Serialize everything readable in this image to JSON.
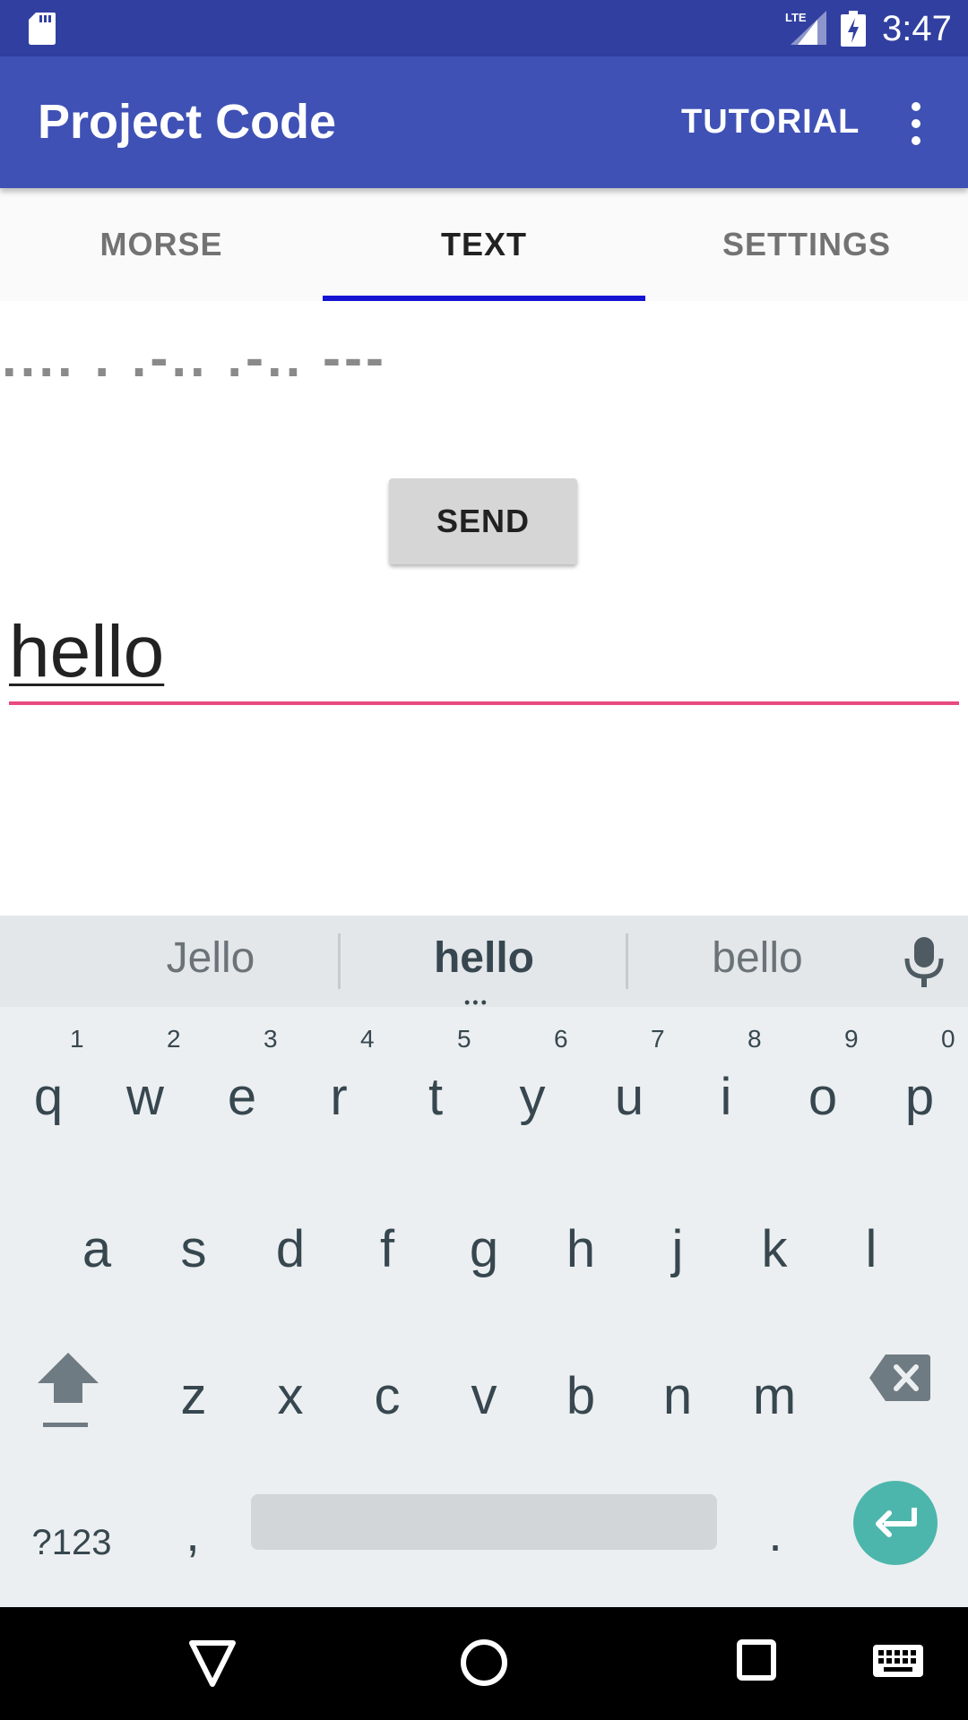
{
  "status_bar": {
    "time": "3:47",
    "icons": [
      "sd-card-icon",
      "lte-signal-icon",
      "battery-charging-icon"
    ]
  },
  "app_bar": {
    "title": "Project Code",
    "tutorial_label": "TUTORIAL",
    "menu_icon": "overflow-menu-icon"
  },
  "tabs": [
    {
      "label": "MORSE"
    },
    {
      "label": "TEXT"
    },
    {
      "label": "SETTINGS"
    }
  ],
  "active_tab": "TEXT",
  "content": {
    "morse_output": ".... . .-.. .-.. ---",
    "send_label": "SEND",
    "input_value": "hello"
  },
  "keyboard": {
    "suggestions": [
      "Jello",
      "hello",
      "bello"
    ],
    "more_indicator": "•••",
    "row1": [
      {
        "key": "q",
        "hint": "1"
      },
      {
        "key": "w",
        "hint": "2"
      },
      {
        "key": "e",
        "hint": "3"
      },
      {
        "key": "r",
        "hint": "4"
      },
      {
        "key": "t",
        "hint": "5"
      },
      {
        "key": "y",
        "hint": "6"
      },
      {
        "key": "u",
        "hint": "7"
      },
      {
        "key": "i",
        "hint": "8"
      },
      {
        "key": "o",
        "hint": "9"
      },
      {
        "key": "p",
        "hint": "0"
      }
    ],
    "row2": [
      "a",
      "s",
      "d",
      "f",
      "g",
      "h",
      "j",
      "k",
      "l"
    ],
    "row3": [
      "z",
      "x",
      "c",
      "v",
      "b",
      "n",
      "m"
    ],
    "symbols_label": "?123",
    "comma": ",",
    "period": ".",
    "icons": [
      "mic-icon",
      "shift-icon",
      "backspace-icon",
      "enter-icon"
    ],
    "accent_color": "#4db6ac"
  },
  "nav_bar": {
    "icons": [
      "back-icon",
      "home-icon",
      "recents-icon",
      "keyboard-switch-icon"
    ]
  },
  "colors": {
    "status_bar": "#3140a0",
    "app_bar": "#3f51b5",
    "tab_indicator": "#1414d2",
    "input_underline": "#e84a7f"
  }
}
